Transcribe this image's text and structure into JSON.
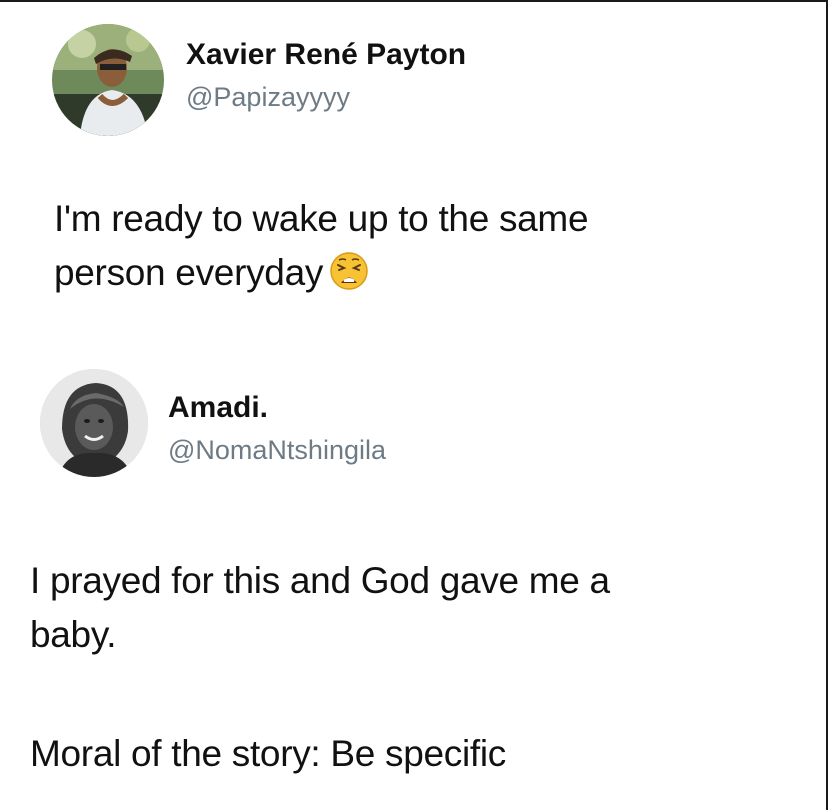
{
  "posts": [
    {
      "author": {
        "display_name": "Xavier René Payton",
        "handle": "@Papizayyyy",
        "avatar": "profile-photo"
      },
      "text_lines": [
        "I'm ready to wake up to the same",
        "person everyday"
      ],
      "emoji": "weary-face-emoji"
    },
    {
      "author": {
        "display_name": "Amadi.",
        "handle": "@NomaNtshingila",
        "avatar": "profile-photo"
      },
      "text_lines": [
        "I prayed for this and God gave me a",
        "baby."
      ],
      "caption": "Moral of the story: Be specific"
    }
  ],
  "colors": {
    "text": "#111111",
    "handle": "#6e7b85",
    "background": "#ffffff",
    "emoji_face": "#f7c233"
  }
}
